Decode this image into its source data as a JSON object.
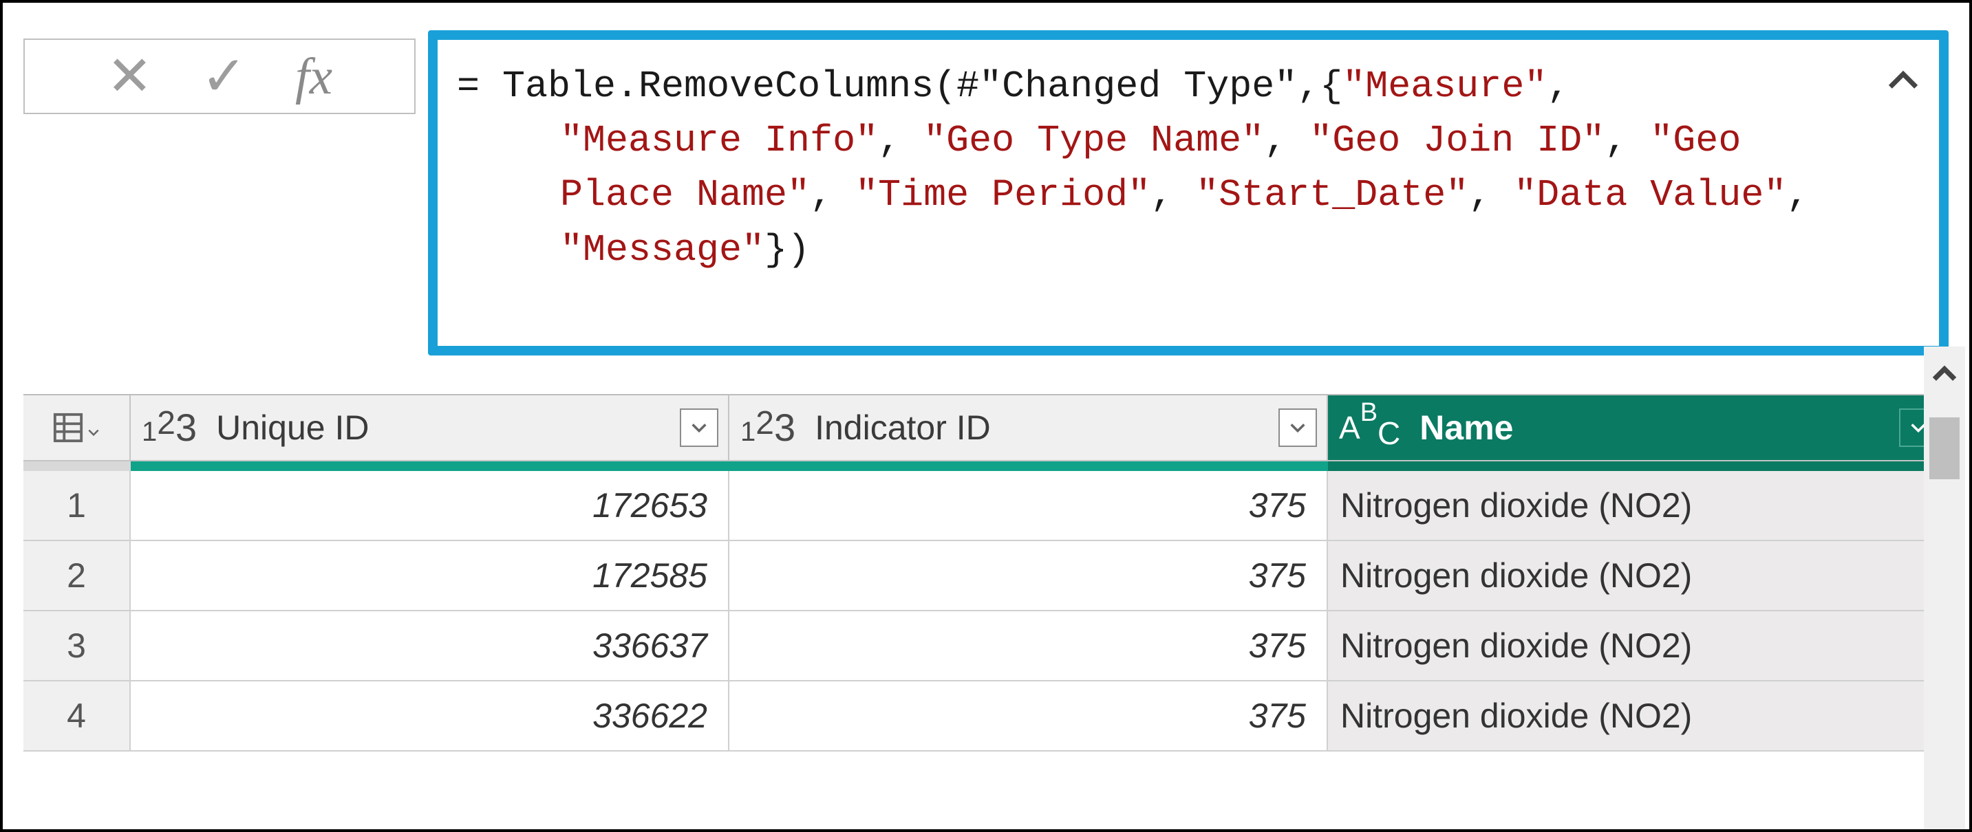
{
  "formula_bar": {
    "fx_label": "fx",
    "cancel_glyph": "✕",
    "confirm_glyph": "✓",
    "expand_glyph": "⌃",
    "tokens": {
      "eq": "= ",
      "fn": "Table.RemoveColumns",
      "open": "(",
      "hash": "#",
      "ref_q1": "\"",
      "ref": "Changed Type",
      "ref_q2": "\"",
      "comma1": ",{",
      "s1": "\"Measure\"",
      "comma_after_s1": ", ",
      "s2": "\"Measure Info\"",
      "c2": ", ",
      "s3": "\"Geo Type Name\"",
      "c3": ", ",
      "s4": "\"Geo Join ID\"",
      "c4": ", ",
      "s5": "\"Geo Place Name\"",
      "c5": ", ",
      "s6": "\"Time Period\"",
      "c6": ", ",
      "s7": "\"Start_Date\"",
      "c7": ", ",
      "s8": "\"Data Value\"",
      "c8": ", ",
      "s9": "\"Message\"",
      "close": "})"
    }
  },
  "table": {
    "columns": [
      {
        "name": "Unique ID",
        "type": "number",
        "selected": false
      },
      {
        "name": "Indicator ID",
        "type": "number",
        "selected": false
      },
      {
        "name": "Name",
        "type": "text",
        "selected": true
      }
    ],
    "rows": [
      {
        "n": "1",
        "unique_id": "172653",
        "indicator_id": "375",
        "name": "Nitrogen dioxide (NO2)"
      },
      {
        "n": "2",
        "unique_id": "172585",
        "indicator_id": "375",
        "name": "Nitrogen dioxide (NO2)"
      },
      {
        "n": "3",
        "unique_id": "336637",
        "indicator_id": "375",
        "name": "Nitrogen dioxide (NO2)"
      },
      {
        "n": "4",
        "unique_id": "336622",
        "indicator_id": "375",
        "name": "Nitrogen dioxide (NO2)"
      }
    ]
  }
}
